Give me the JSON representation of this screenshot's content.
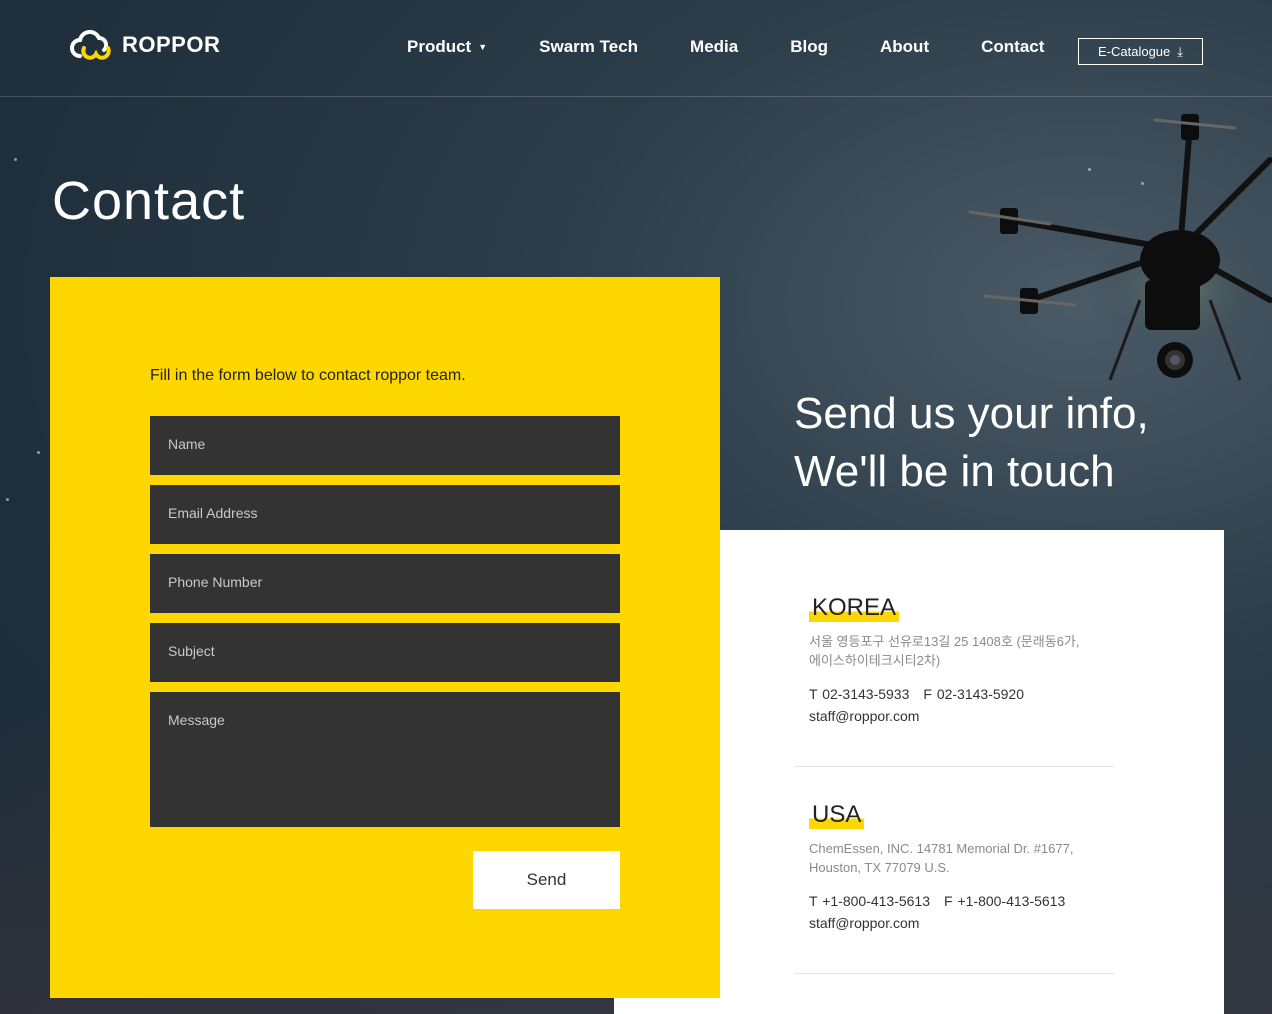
{
  "brand": {
    "name": "ROPPOR",
    "accent": "#ffd700"
  },
  "nav": {
    "items": [
      {
        "label": "Product",
        "has_dropdown": true
      },
      {
        "label": "Swarm Tech"
      },
      {
        "label": "Media"
      },
      {
        "label": "Blog"
      },
      {
        "label": "About"
      },
      {
        "label": "Contact"
      }
    ],
    "catalogue_label": "E-Catalogue",
    "catalogue_icon": "download-icon"
  },
  "page": {
    "title": "Contact"
  },
  "form": {
    "intro": "Fill in the form below to contact roppor team.",
    "fields": {
      "name": "Name",
      "email": "Email Address",
      "phone": "Phone Number",
      "subject": "Subject",
      "message": "Message"
    },
    "send_label": "Send"
  },
  "tagline": {
    "line1": "Send us your info,",
    "line2": "We'll be in touch"
  },
  "offices": [
    {
      "name": "KOREA",
      "address_line1": "서울 영등포구 선유로13길 25 1408호 (문래동6가,",
      "address_line2": "에이스하이테크시티2차)",
      "phone": "T 02-3143-5933",
      "fax": "F 02-3143-5920",
      "email": "staff@roppor.com"
    },
    {
      "name": "USA",
      "address_line1": "ChemEssen, INC. 14781 Memorial Dr. #1677,",
      "address_line2": "Houston, TX 77079 U.S.",
      "phone": "T +1-800-413-5613",
      "fax": "F +1-800-413-5613",
      "email": "staff@roppor.com"
    }
  ]
}
